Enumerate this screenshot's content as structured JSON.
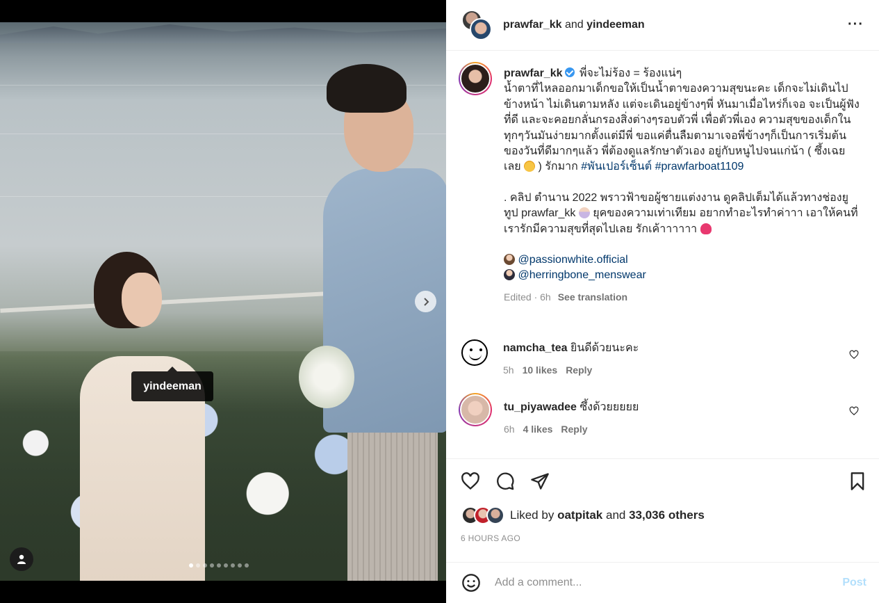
{
  "media": {
    "tag_label": "yindeeman",
    "carousel_dots": 9,
    "active_dot": 0
  },
  "header": {
    "user1": "prawfar_kk",
    "joiner": "and",
    "user2": "yindeeman"
  },
  "caption": {
    "username": "prawfar_kk",
    "first_line": "พี่จะไม่ร้อง = ร้องแน่ๆ",
    "body": "น้ำตาที่ไหลออกมาเด็กขอให้เป็นน้ำตาของความสุขนะคะ เด็กจะไม่เดินไปข้างหน้า ไม่เดินตามหลัง แต่จะเดินอยู่ข้างๆพี่ หันมาเมื่อไหร่ก็เจอ จะเป็นผู้ฟังที่ดี และจะคอยกลั่นกรองสิ่งต่างๆรอบตัวพี่ เพื่อตัวพี่เอง ความสุขของเด็กในทุกๆวันมันง่ายมากตั้งแต่มีพี่ ขอแค่ตื่นลืมตามาเจอพี่ข้างๆก็เป็นการเริ่มต้นของวันที่ดีมากๆแล้ว พี่ต้องดูแลรักษาตัวเอง อยู่กับหนูไปจนแก่น้า ( ซึ้งเฉยเลย ",
    "body_end": " ) รักมาก ",
    "hashtag1": "#พันเปอร์เซ็นต์",
    "hashtag2": "#prawfarboat1109",
    "para2_a": ". คลิป ตำนาน 2022 พราวฟ้าขอผู้ชายแต่งงาน ดูคลิปเต็มได้แล้วทางช่องยูทูป prawfar_kk ",
    "para2_b": " ยุคของความเท่าเทียม อยากทำอะไรทำค่าาา เอาให้คนที่เรารักมีความสุขที่สุดไปเลย รักเค้าาาาาา ",
    "mention1": "@passionwhite.official",
    "mention2": "@herringbone_menswear",
    "edited": "Edited · 6h",
    "see_translation": "See translation"
  },
  "comments": [
    {
      "username": "namcha_tea",
      "text": "ยินดีด้วยนะคะ",
      "time": "5h",
      "likes": "10 likes",
      "reply": "Reply"
    },
    {
      "username": "tu_piyawadee",
      "text": "ซึ้งด้วยยยยย",
      "time": "6h",
      "likes": "4 likes",
      "reply": "Reply"
    }
  ],
  "likes": {
    "prefix": "Liked by",
    "user": "oatpitak",
    "joiner": "and",
    "count": "33,036 others"
  },
  "timeago": "6 HOURS AGO",
  "comment_box": {
    "placeholder": "Add a comment...",
    "post": "Post"
  },
  "icons": [
    "chevron-right-icon",
    "user-icon",
    "more-icon",
    "verified-icon",
    "heart-icon",
    "comment-icon",
    "share-icon",
    "bookmark-icon",
    "emoji-icon"
  ],
  "colors": {
    "link": "#00376b",
    "post_disabled": "#b2dffc",
    "verified": "#3897f0"
  }
}
